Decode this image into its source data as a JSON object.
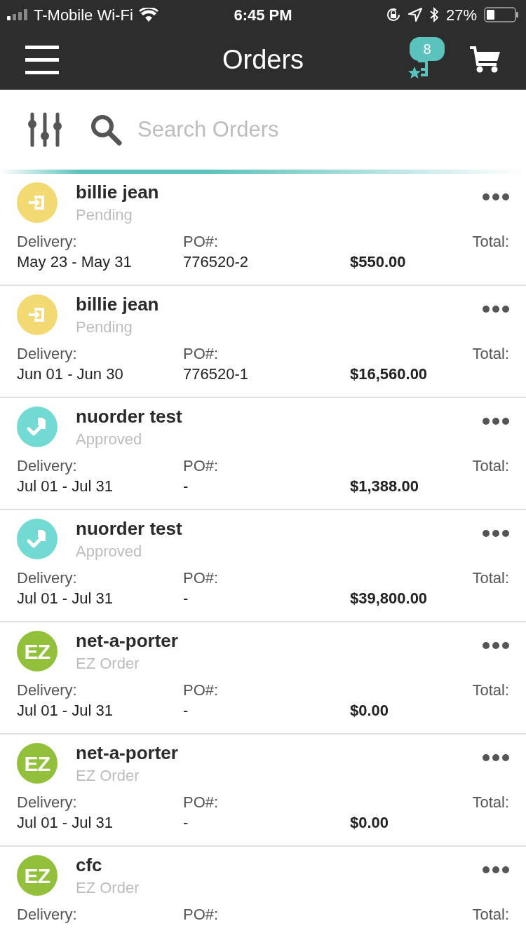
{
  "status_bar": {
    "carrier": "T-Mobile Wi-Fi",
    "time": "6:45 PM",
    "battery": "27%"
  },
  "nav": {
    "title": "Orders",
    "badge": "8"
  },
  "search": {
    "placeholder": "Search Orders"
  },
  "orders": [
    {
      "kind": "pending",
      "name": "billie jean",
      "status": "Pending",
      "delivery_label": "Delivery:",
      "delivery": "May 23 - May 31",
      "po_label": "PO#:",
      "po": "776520-2",
      "total_label": "Total:",
      "total": "$550.00"
    },
    {
      "kind": "pending",
      "name": "billie jean",
      "status": "Pending",
      "delivery_label": "Delivery:",
      "delivery": "Jun 01 - Jun 30",
      "po_label": "PO#:",
      "po": "776520-1",
      "total_label": "Total:",
      "total": "$16,560.00"
    },
    {
      "kind": "approved",
      "name": "nuorder test",
      "status": "Approved",
      "delivery_label": "Delivery:",
      "delivery": "Jul 01 - Jul 31",
      "po_label": "PO#:",
      "po": "-",
      "total_label": "Total:",
      "total": "$1,388.00"
    },
    {
      "kind": "approved",
      "name": "nuorder test",
      "status": "Approved",
      "delivery_label": "Delivery:",
      "delivery": "Jul 01 - Jul 31",
      "po_label": "PO#:",
      "po": "-",
      "total_label": "Total:",
      "total": "$39,800.00"
    },
    {
      "kind": "ez",
      "icon_text": "EZ",
      "name": "net-a-porter",
      "status": "EZ Order",
      "delivery_label": "Delivery:",
      "delivery": "Jul 01 - Jul 31",
      "po_label": "PO#:",
      "po": "-",
      "total_label": "Total:",
      "total": "$0.00"
    },
    {
      "kind": "ez",
      "icon_text": "EZ",
      "name": "net-a-porter",
      "status": "EZ Order",
      "delivery_label": "Delivery:",
      "delivery": "Jul 01 - Jul 31",
      "po_label": "PO#:",
      "po": "-",
      "total_label": "Total:",
      "total": "$0.00"
    },
    {
      "kind": "ez",
      "icon_text": "EZ",
      "name": "cfc",
      "status": "EZ Order",
      "delivery_label": "Delivery:",
      "po_label": "PO#:",
      "total_label": "Total:"
    }
  ]
}
